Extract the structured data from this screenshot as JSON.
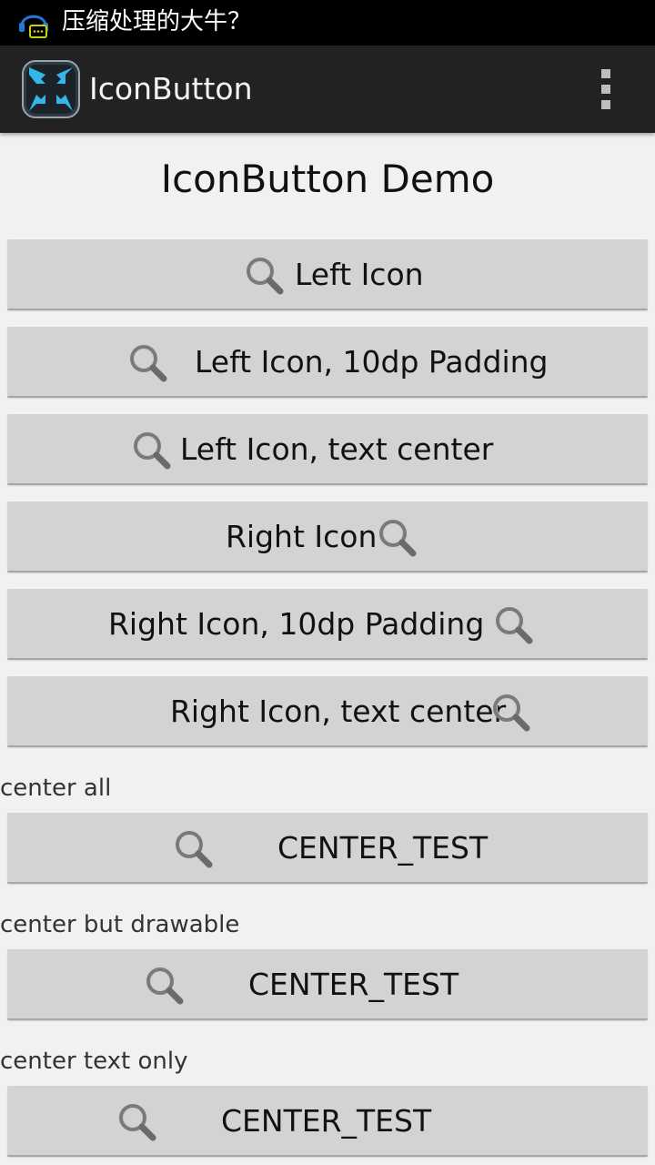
{
  "status_bar": {
    "notification_text": "压缩处理的大牛？",
    "notification_icon": "chat-headset-icon"
  },
  "action_bar": {
    "app_title": "IconButton",
    "app_icon": "compress-arrows-icon",
    "overflow_icon": "overflow-menu-icon"
  },
  "main": {
    "demo_title": "IconButton Demo",
    "buttons": [
      {
        "label": "Left Icon",
        "icon": "search-icon"
      },
      {
        "label": "Left Icon, 10dp Padding",
        "icon": "search-icon"
      },
      {
        "label": "Left Icon, text center",
        "icon": "search-icon"
      },
      {
        "label": "Right Icon",
        "icon": "search-icon"
      },
      {
        "label": "Right Icon, 10dp Padding",
        "icon": "search-icon"
      },
      {
        "label": "Right Icon, text center",
        "icon": "search-icon"
      }
    ],
    "sections": [
      {
        "label": "center all",
        "button_label": "CENTER_TEST",
        "icon": "search-icon"
      },
      {
        "label": "center but drawable",
        "button_label": "CENTER_TEST",
        "icon": "search-icon"
      },
      {
        "label": "center text only",
        "button_label": "CENTER_TEST",
        "icon": "search-icon"
      }
    ]
  },
  "colors": {
    "status_bar_bg": "#000000",
    "action_bar_bg": "#222222",
    "page_bg": "#f1f1f1",
    "button_bg": "#d3d3d3",
    "icon_gray": "#777777",
    "app_icon_blue": "#35b6ea"
  }
}
